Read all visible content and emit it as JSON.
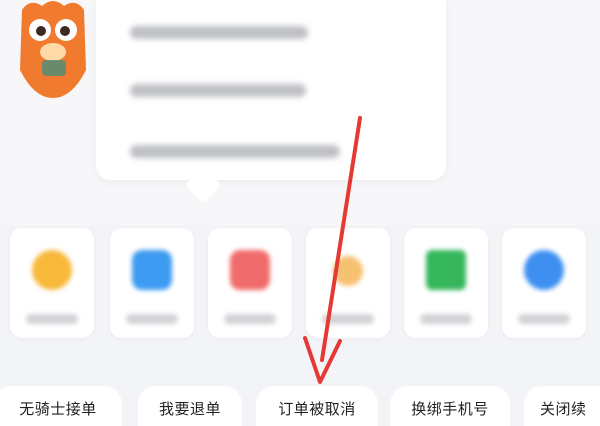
{
  "chips": [
    {
      "label": "无骑士接单"
    },
    {
      "label": "我要退单"
    },
    {
      "label": "订单被取消"
    },
    {
      "label": "换绑手机号"
    },
    {
      "label": "关闭续"
    }
  ],
  "popup": {
    "items": [
      {
        "icon": "blurred-text"
      },
      {
        "icon": "blurred-text"
      },
      {
        "icon": "blurred-text"
      }
    ]
  },
  "icons": {
    "mascot": "mascot-avatar-icon",
    "arrow": "pointer-arrow-icon"
  },
  "colors": {
    "arrow": "#e53935",
    "mascot": "#f07a2e",
    "card_icons": [
      "#f8b83a",
      "#3d9bf1",
      "#f06b6b",
      "#f6c170",
      "#35b65b",
      "#3d8ff0"
    ]
  }
}
